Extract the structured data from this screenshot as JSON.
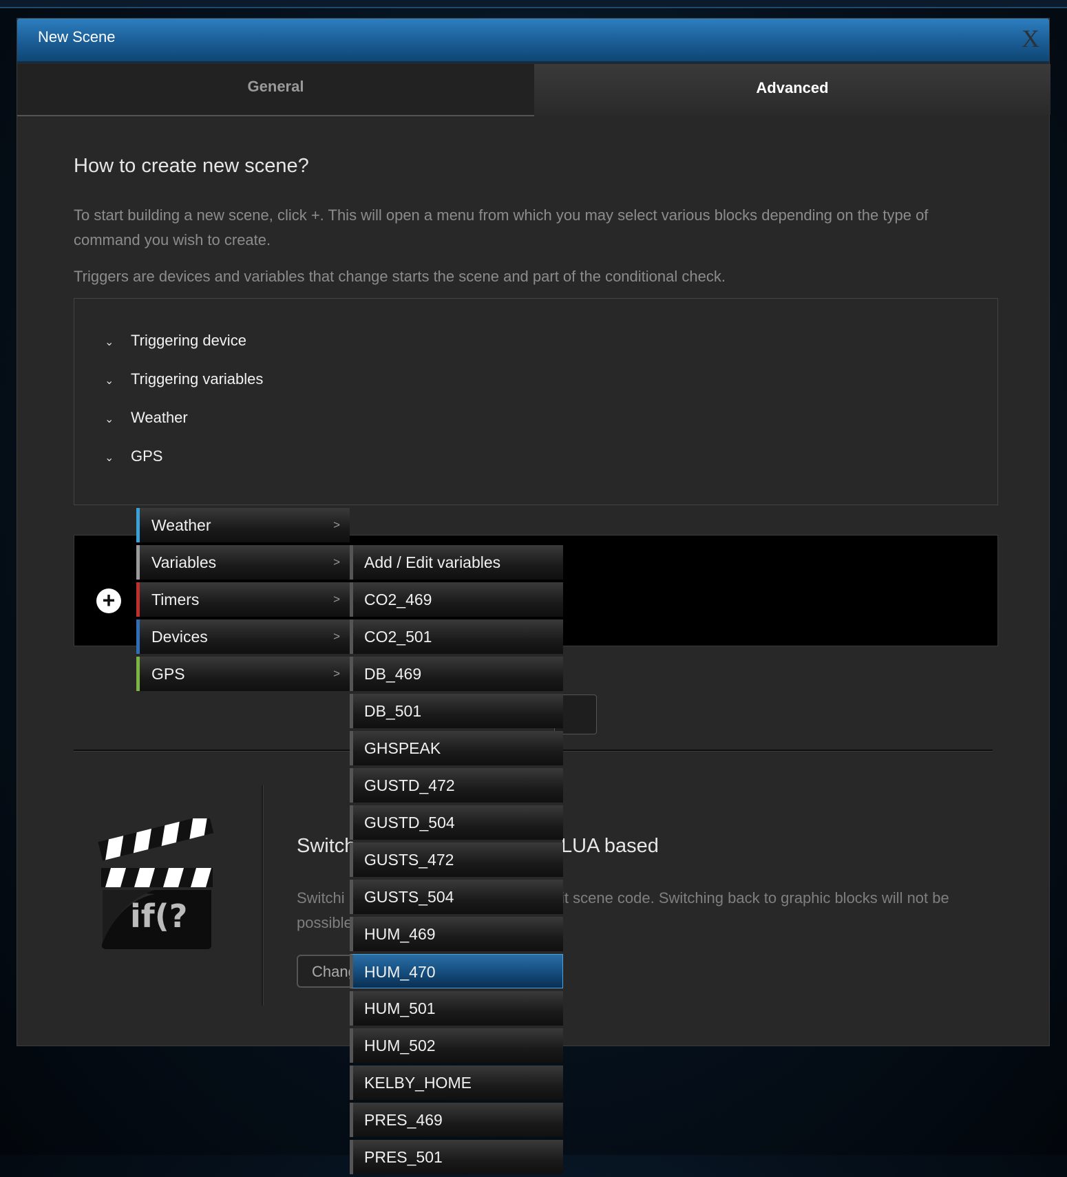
{
  "window": {
    "title": "New Scene",
    "close_label": "X"
  },
  "tabs": [
    {
      "label": "General"
    },
    {
      "label": "Advanced"
    }
  ],
  "intro": {
    "heading": "How to create new scene?",
    "p1": "To start building a new scene, click +. This will open a menu from which you may select various blocks depending on the type of command you wish to create.",
    "p2": "Triggers are devices and variables that change starts the scene and part of the conditional check."
  },
  "triggers": [
    {
      "label": "Triggering device"
    },
    {
      "label": "Triggering variables"
    },
    {
      "label": "Weather"
    },
    {
      "label": "GPS"
    }
  ],
  "plus_label": "+",
  "block_menu": [
    {
      "label": "Weather",
      "color": "#3aa0d8"
    },
    {
      "label": "Variables",
      "color": "#9a9a9a"
    },
    {
      "label": "Timers",
      "color": "#c0302a"
    },
    {
      "label": "Devices",
      "color": "#2e6fb8"
    },
    {
      "label": "GPS",
      "color": "#7cb342"
    }
  ],
  "submenu_arrow": ">",
  "variables_menu": [
    "Add / Edit variables",
    "CO2_469",
    "CO2_501",
    "DB_469",
    "DB_501",
    "GHSPEAK",
    "GUSTD_472",
    "GUSTD_504",
    "GUSTS_472",
    "GUSTS_504",
    "HUM_469",
    "HUM_470",
    "HUM_501",
    "HUM_502",
    "KELBY_HOME",
    "PRES_469",
    "PRES_501"
  ],
  "variables_active": "HUM_470",
  "lua": {
    "title_left": "Switch",
    "title_right": "LUA based",
    "para_line1_left": "Switchi",
    "para_line1_right": "it scene code. Switching back to graphic blocks will not be",
    "para_line2_left": "possible",
    "button_label": "Change",
    "icon_text": "if(?"
  }
}
